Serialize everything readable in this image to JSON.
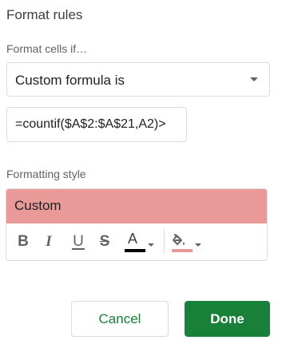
{
  "panel": {
    "title": "Format rules",
    "condition_label": "Format cells if…",
    "condition_value": "Custom formula is",
    "formula_value": "=countif($A$2:$A$21,A2)>",
    "style_label": "Formatting style",
    "preview_text": "Custom",
    "fill_color": "#ea9999",
    "text_color_bar": "#000000"
  },
  "toolbar": {
    "bold": "B",
    "italic": "I",
    "underline": "U",
    "strikethrough": "S",
    "text_color": "A",
    "icons": [
      "bold-icon",
      "italic-icon",
      "underline-icon",
      "strikethrough-icon",
      "text-color-icon",
      "fill-color-icon"
    ]
  },
  "buttons": {
    "cancel": "Cancel",
    "done": "Done"
  },
  "colors": {
    "accent": "#188038",
    "border": "#dadce0"
  }
}
